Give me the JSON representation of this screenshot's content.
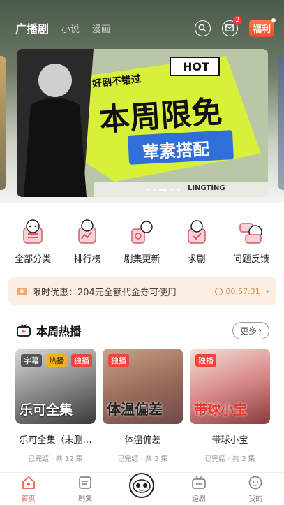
{
  "header": {
    "tabs": [
      {
        "label": "广播剧",
        "active": true
      },
      {
        "label": "小说",
        "active": false
      },
      {
        "label": "漫画",
        "active": false
      }
    ],
    "mail_badge": "2",
    "welfare_label": "福利"
  },
  "banner": {
    "hot_label": "HOT",
    "kicker": "好剧不错过",
    "headline": "本周限免",
    "subline": "荤素搭配",
    "brand": "LINGTING"
  },
  "categories": [
    {
      "label": "全部分类",
      "icon": "cat-list-icon"
    },
    {
      "label": "排行榜",
      "icon": "cat-rank-icon"
    },
    {
      "label": "剧集更新",
      "icon": "cat-update-icon"
    },
    {
      "label": "求剧",
      "icon": "cat-request-icon"
    },
    {
      "label": "问题反馈",
      "icon": "cat-help-icon"
    }
  ],
  "promo": {
    "text": "限时优惠：204元全额代金券可使用",
    "countdown": "00:57:31"
  },
  "section": {
    "title": "本周热播",
    "more_label": "更多"
  },
  "cards": [
    {
      "name": "乐可全集（未删…",
      "meta": "已完结 · 共 12 集",
      "tags": [
        "字幕",
        "热播",
        "独播"
      ],
      "cover_text": "乐可全集"
    },
    {
      "name": "体温偏差",
      "meta": "已完结 · 共 3 集",
      "tags": [
        "独播"
      ],
      "cover_text": "体温偏差"
    },
    {
      "name": "带球小宝",
      "meta": "已完结 · 共 3 集",
      "tags": [
        "独播"
      ],
      "cover_text": "带球小宝"
    }
  ],
  "bottom_nav": [
    {
      "label": "首页",
      "active": true
    },
    {
      "label": "剧集",
      "active": false
    },
    {
      "label": "",
      "active": false
    },
    {
      "label": "追剧",
      "active": false
    },
    {
      "label": "我的",
      "active": false
    }
  ],
  "colors": {
    "accent": "#f25a4a",
    "tag_red": "#f0443a",
    "tag_orange": "#f5b01e",
    "promo_bg": "#fbeee3"
  }
}
